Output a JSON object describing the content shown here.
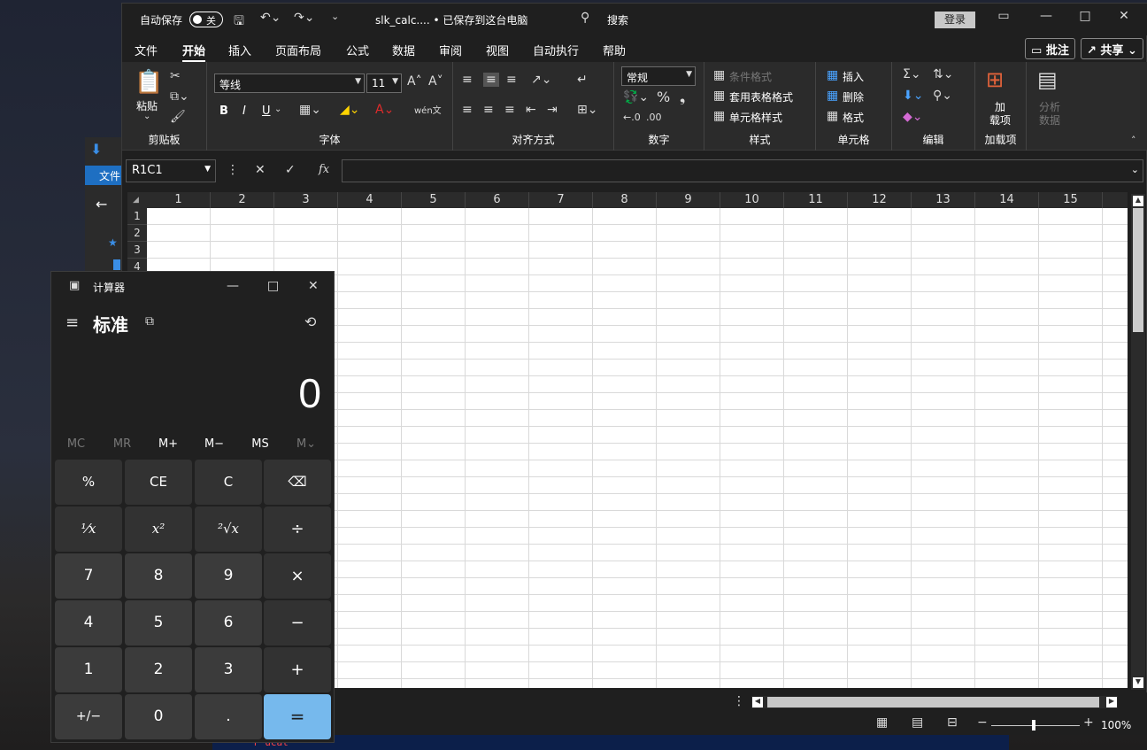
{
  "excel": {
    "autosave_label": "自动保存",
    "autosave_state": "关",
    "doc_title": "slk_calc.... • 已保存到这台电脑",
    "search_label": "搜索",
    "login_label": "登录",
    "menu": [
      "文件",
      "开始",
      "插入",
      "页面布局",
      "公式",
      "数据",
      "审阅",
      "视图",
      "自动执行",
      "帮助"
    ],
    "comments_btn": "批注",
    "share_btn": "共享",
    "ribbon": {
      "clipboard": {
        "paste": "粘贴",
        "label": "剪贴板"
      },
      "font": {
        "name": "等线",
        "size": "11",
        "label": "字体",
        "bold": "B",
        "italic": "I",
        "underline": "U"
      },
      "align": {
        "label": "对齐方式"
      },
      "number": {
        "format": "常规",
        "label": "数字"
      },
      "styles": {
        "cond": "条件格式",
        "table": "套用表格格式",
        "cell": "单元格样式",
        "label": "样式"
      },
      "cells": {
        "insert": "插入",
        "delete": "删除",
        "format": "格式",
        "label": "单元格"
      },
      "edit": {
        "label": "编辑"
      },
      "addins": {
        "line1": "加",
        "line2": "载项",
        "label": "加载项"
      },
      "analyze": {
        "line1": "分析",
        "line2": "数据"
      }
    },
    "name_box": "R1C1",
    "fx": "fx",
    "columns": [
      "1",
      "2",
      "3",
      "4",
      "5",
      "6",
      "7",
      "8",
      "9",
      "10",
      "11",
      "12",
      "13",
      "14",
      "15"
    ],
    "rows": [
      "1",
      "2",
      "3",
      "4"
    ],
    "zoom": "100%"
  },
  "bgwin": {
    "file": "文件"
  },
  "calc": {
    "title": "计算器",
    "mode": "标准",
    "display": "0",
    "memory": [
      "MC",
      "MR",
      "M+",
      "M−",
      "MS",
      "M⌄"
    ],
    "keys": [
      "%",
      "CE",
      "C",
      "⌫",
      "¹⁄x",
      "x²",
      "²√x",
      "÷",
      "7",
      "8",
      "9",
      "×",
      "4",
      "5",
      "6",
      "−",
      "1",
      "2",
      "3",
      "+",
      "+/−",
      "0",
      ".",
      "="
    ]
  },
  "terminal": {
    "text": "r ucat"
  }
}
